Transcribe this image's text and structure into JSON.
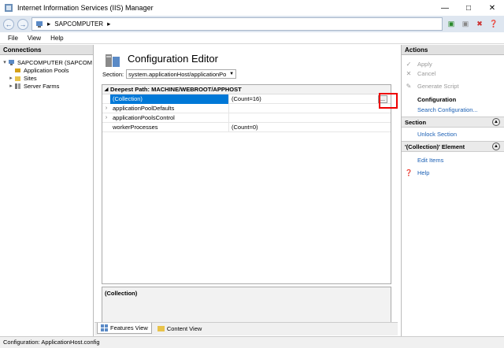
{
  "window": {
    "title": "Internet Information Services (IIS) Manager"
  },
  "address": {
    "crumbs": [
      "SAPCOMPUTER"
    ]
  },
  "menu": [
    "File",
    "View",
    "Help"
  ],
  "connections": {
    "header": "Connections",
    "tree": [
      {
        "label": "SAPCOMPUTER (SAPCOM",
        "icon": "server-icon",
        "expanded": true,
        "level": 0
      },
      {
        "label": "Application Pools",
        "icon": "app-pools-icon",
        "expanded": null,
        "level": 1
      },
      {
        "label": "Sites",
        "icon": "sites-icon",
        "expanded": false,
        "level": 1
      },
      {
        "label": "Server Farms",
        "icon": "server-farms-icon",
        "expanded": false,
        "level": 1
      }
    ]
  },
  "editor": {
    "title": "Configuration Editor",
    "section_label": "Section:",
    "section_value": "system.applicationHost/applicationPo",
    "grid_header": "Deepest Path: MACHINE/WEBROOT/APPHOST",
    "rows": [
      {
        "name": "(Collection)",
        "value": "(Count=16)",
        "expandable": false,
        "selected": true
      },
      {
        "name": "applicationPoolDefaults",
        "value": "",
        "expandable": true,
        "selected": false
      },
      {
        "name": "applicationPoolsControl",
        "value": "",
        "expandable": true,
        "selected": false
      },
      {
        "name": "workerProcesses",
        "value": "(Count=0)",
        "expandable": false,
        "selected": false
      }
    ],
    "ellipsis": "...",
    "description": "(Collection)"
  },
  "view_tabs": {
    "features": "Features View",
    "content": "Content View"
  },
  "actions": {
    "header": "Actions",
    "apply": "Apply",
    "cancel": "Cancel",
    "generate_script": "Generate Script",
    "configuration_header": "Configuration",
    "search_configuration": "Search Configuration...",
    "section_header": "Section",
    "unlock_section": "Unlock Section",
    "collection_header": "'(Collection)' Element",
    "edit_items": "Edit Items",
    "help": "Help"
  },
  "status": {
    "text": "Configuration: ApplicationHost.config"
  },
  "colors": {
    "selection": "#0078d7",
    "link": "#1a5fb4",
    "highlight": "#e00000"
  }
}
